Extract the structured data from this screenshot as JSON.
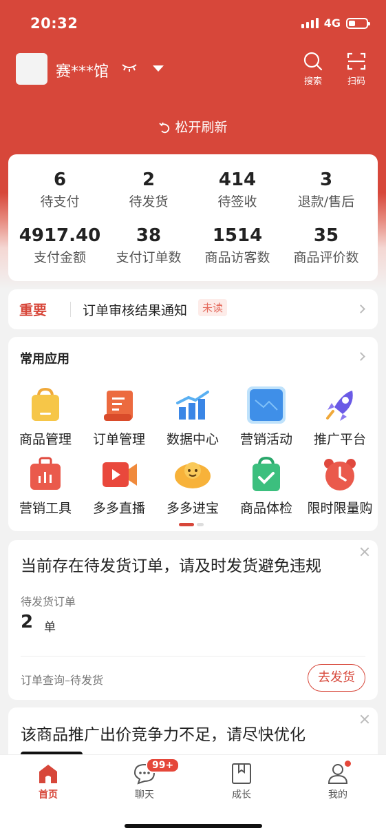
{
  "status_bar": {
    "time": "20:32",
    "network": "4G"
  },
  "header": {
    "shop_name": "赛***馆",
    "search_label": "搜索",
    "scan_label": "扫码"
  },
  "refresh_text": "松开刷新",
  "stats": [
    {
      "value": "6",
      "label": "待支付"
    },
    {
      "value": "2",
      "label": "待发货"
    },
    {
      "value": "414",
      "label": "待签收"
    },
    {
      "value": "3",
      "label": "退款/售后"
    },
    {
      "value": "4917.40",
      "label": "支付金额"
    },
    {
      "value": "38",
      "label": "支付订单数"
    },
    {
      "value": "1514",
      "label": "商品访客数"
    },
    {
      "value": "35",
      "label": "商品评价数"
    }
  ],
  "notice": {
    "tag": "重要",
    "text": "订单审核结果通知",
    "badge": "未读"
  },
  "apps": {
    "title": "常用应用",
    "items": [
      {
        "label": "商品管理",
        "icon": "shopping-bag-icon"
      },
      {
        "label": "订单管理",
        "icon": "order-list-icon"
      },
      {
        "label": "数据中心",
        "icon": "bar-chart-icon"
      },
      {
        "label": "营销活动",
        "icon": "marketing-card-icon"
      },
      {
        "label": "推广平台",
        "icon": "rocket-icon"
      },
      {
        "label": "营销工具",
        "icon": "toolbox-icon"
      },
      {
        "label": "多多直播",
        "icon": "video-play-icon"
      },
      {
        "label": "多多进宝",
        "icon": "treasure-icon"
      },
      {
        "label": "商品体检",
        "icon": "check-bag-icon"
      },
      {
        "label": "限时限量购",
        "icon": "alarm-clock-icon"
      }
    ],
    "page_indicator": {
      "current": 1,
      "total": 2
    }
  },
  "ship_card": {
    "headline": "当前存在待发货订单，请及时发货避免违规",
    "sub_label": "待发货订单",
    "count": "2",
    "unit": "单",
    "footer": "订单查询–待发货",
    "button": "去发货"
  },
  "promo_card": {
    "headline": "该商品推广出价竞争力不足，请尽快优化"
  },
  "tabbar": {
    "items": [
      {
        "label": "首页",
        "active": true
      },
      {
        "label": "聊天",
        "badge": "99+"
      },
      {
        "label": "成长"
      },
      {
        "label": "我的",
        "dot": true
      }
    ]
  },
  "colors": {
    "brand": "#d7473a",
    "background": "#f2f2f2"
  }
}
